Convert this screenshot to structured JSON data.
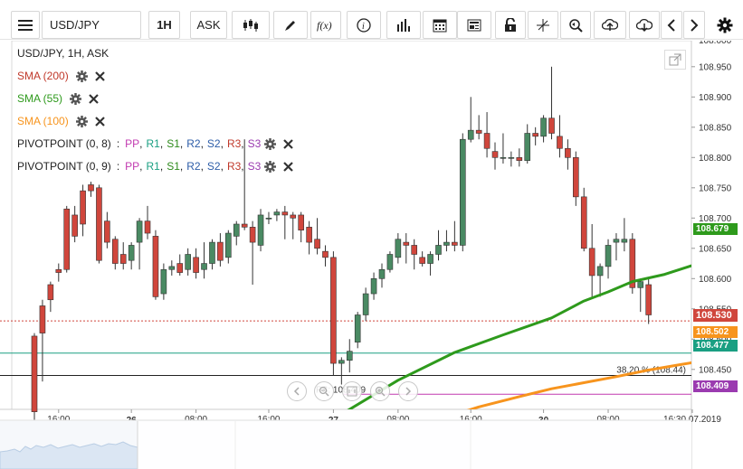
{
  "toolbar": {
    "symbol": "USD/JPY",
    "interval": "1H",
    "price_type": "ASK"
  },
  "legend": {
    "title": "USD/JPY, 1H, ASK",
    "sma200": "SMA (200)",
    "sma55": "SMA (55)",
    "sma100": "SMA (100)",
    "pivot1_label": "PIVOTPOINT (0, 8)",
    "pivot2_label": "PIVOTPOINT (0, 9)",
    "pivot_sep": ":",
    "pivot_parts": [
      "PP",
      "R1",
      "S1",
      "R2",
      "S2",
      "R3",
      "S3"
    ],
    "comma": ","
  },
  "colors": {
    "up": "#4a8a63",
    "down": "#d0463c",
    "sma55": "#2e9a1c",
    "sma100": "#f7941d",
    "sma200": "#c0392b",
    "teal": "#1a9f82",
    "pivot_pink": "#c23ab0",
    "pp": "#c23ab0",
    "r1": "#1a9f82",
    "s1": "#2e8a1c",
    "r2": "#2d5da8",
    "s2": "#2d5da8",
    "r3": "#c0392b",
    "s3": "#9b3bb0"
  },
  "chart_data": {
    "type": "candlestick",
    "ylim": [
      108.384,
      108.993
    ],
    "y_ticks": [
      "108.950",
      "108.900",
      "108.850",
      "108.800",
      "108.750",
      "108.700",
      "108.650",
      "108.600",
      "108.550",
      "108.500",
      "108.450"
    ],
    "top_partial_tick": "108.000",
    "x_ticks": [
      "16:00",
      "26",
      "08:00",
      "16:00",
      "27",
      "08:00",
      "16:00",
      "30",
      "08:00",
      "16:30.07.2019"
    ],
    "price_labels": {
      "sma55": "108.679",
      "last": "108.530",
      "sma100": "108.502",
      "teal_line": "108.477",
      "pivot": "108.409"
    },
    "fib_label": "38.20 % (108.44)",
    "pivot_text": "PS: 108.409",
    "candles": [
      [
        108.505,
        108.51,
        108.35,
        108.38
      ],
      [
        108.555,
        108.565,
        108.43,
        108.51
      ],
      [
        108.59,
        108.595,
        108.545,
        108.565
      ],
      [
        108.615,
        108.625,
        108.595,
        108.61
      ],
      [
        108.715,
        108.72,
        108.61,
        108.615
      ],
      [
        108.705,
        108.72,
        108.66,
        108.67
      ],
      [
        108.745,
        108.755,
        108.67,
        108.69
      ],
      [
        108.755,
        108.76,
        108.735,
        108.745
      ],
      [
        108.75,
        108.755,
        108.625,
        108.63
      ],
      [
        108.695,
        108.71,
        108.65,
        108.66
      ],
      [
        108.665,
        108.67,
        108.615,
        108.625
      ],
      [
        108.64,
        108.66,
        108.615,
        108.625
      ],
      [
        108.63,
        108.66,
        108.615,
        108.655
      ],
      [
        108.66,
        108.7,
        108.615,
        108.695
      ],
      [
        108.695,
        108.72,
        108.665,
        108.675
      ],
      [
        108.67,
        108.68,
        108.565,
        108.57
      ],
      [
        108.575,
        108.625,
        108.565,
        108.615
      ],
      [
        108.615,
        108.63,
        108.605,
        108.62
      ],
      [
        108.625,
        108.64,
        108.605,
        108.61
      ],
      [
        108.615,
        108.65,
        108.605,
        108.64
      ],
      [
        108.635,
        108.65,
        108.6,
        108.61
      ],
      [
        108.615,
        108.66,
        108.6,
        108.625
      ],
      [
        108.625,
        108.665,
        108.615,
        108.66
      ],
      [
        108.66,
        108.675,
        108.62,
        108.63
      ],
      [
        108.635,
        108.68,
        108.625,
        108.675
      ],
      [
        108.67,
        108.695,
        108.655,
        108.69
      ],
      [
        108.69,
        108.83,
        108.68,
        108.685
      ],
      [
        108.685,
        108.695,
        108.59,
        108.66
      ],
      [
        108.655,
        108.715,
        108.645,
        108.705
      ],
      [
        108.7,
        108.71,
        108.69,
        108.7
      ],
      [
        108.705,
        108.715,
        108.695,
        108.71
      ],
      [
        108.71,
        108.72,
        108.665,
        108.705
      ],
      [
        108.705,
        108.71,
        108.665,
        108.7
      ],
      [
        108.705,
        108.71,
        108.66,
        108.68
      ],
      [
        108.685,
        108.695,
        108.64,
        108.66
      ],
      [
        108.665,
        108.7,
        108.64,
        108.65
      ],
      [
        108.645,
        108.655,
        108.62,
        108.635
      ],
      [
        108.635,
        108.645,
        108.44,
        108.46
      ],
      [
        108.46,
        108.47,
        108.425,
        108.465
      ],
      [
        108.465,
        108.5,
        108.445,
        108.48
      ],
      [
        108.495,
        108.545,
        108.485,
        108.54
      ],
      [
        108.54,
        108.585,
        108.53,
        108.575
      ],
      [
        108.575,
        108.61,
        108.565,
        108.6
      ],
      [
        108.6,
        108.625,
        108.585,
        108.615
      ],
      [
        108.615,
        108.645,
        108.61,
        108.64
      ],
      [
        108.635,
        108.675,
        108.625,
        108.665
      ],
      [
        108.66,
        108.675,
        108.625,
        108.655
      ],
      [
        108.655,
        108.665,
        108.615,
        108.64
      ],
      [
        108.635,
        108.645,
        108.62,
        108.625
      ],
      [
        108.625,
        108.645,
        108.605,
        108.64
      ],
      [
        108.64,
        108.68,
        108.63,
        108.655
      ],
      [
        108.655,
        108.68,
        108.645,
        108.66
      ],
      [
        108.66,
        108.695,
        108.645,
        108.655
      ],
      [
        108.655,
        108.84,
        108.645,
        108.83
      ],
      [
        108.83,
        108.9,
        108.825,
        108.845
      ],
      [
        108.845,
        108.87,
        108.83,
        108.84
      ],
      [
        108.84,
        108.875,
        108.8,
        108.815
      ],
      [
        108.81,
        108.825,
        108.78,
        108.8
      ],
      [
        108.8,
        108.84,
        108.79,
        108.8
      ],
      [
        108.8,
        108.81,
        108.785,
        108.8
      ],
      [
        108.8,
        108.815,
        108.785,
        108.795
      ],
      [
        108.795,
        108.855,
        108.79,
        108.84
      ],
      [
        108.84,
        108.85,
        108.82,
        108.835
      ],
      [
        108.835,
        108.87,
        108.825,
        108.865
      ],
      [
        108.865,
        108.95,
        108.83,
        108.84
      ],
      [
        108.835,
        108.87,
        108.8,
        108.815
      ],
      [
        108.815,
        108.83,
        108.78,
        108.8
      ],
      [
        108.8,
        108.81,
        108.72,
        108.735
      ],
      [
        108.735,
        108.75,
        108.645,
        108.65
      ],
      [
        108.65,
        108.69,
        108.57,
        108.605
      ],
      [
        108.605,
        108.625,
        108.57,
        108.62
      ],
      [
        108.62,
        108.665,
        108.6,
        108.655
      ],
      [
        108.66,
        108.675,
        108.63,
        108.665
      ],
      [
        108.66,
        108.7,
        108.645,
        108.665
      ],
      [
        108.665,
        108.675,
        108.575,
        108.585
      ],
      [
        108.585,
        108.6,
        108.545,
        108.595
      ],
      [
        108.59,
        108.6,
        108.525,
        108.54
      ]
    ],
    "sma55_points": [
      [
        36,
        108.36
      ],
      [
        45,
        108.432
      ],
      [
        52,
        108.478
      ],
      [
        58,
        108.507
      ],
      [
        64,
        108.535
      ],
      [
        68,
        108.563
      ],
      [
        71,
        108.578
      ],
      [
        74,
        108.595
      ],
      [
        78,
        108.607
      ],
      [
        81,
        108.62
      ],
      [
        84,
        108.633
      ],
      [
        87,
        108.645
      ],
      [
        91,
        108.657
      ],
      [
        95,
        108.664
      ],
      [
        98,
        108.673
      ],
      [
        101,
        108.679
      ],
      [
        104,
        108.682
      ],
      [
        108,
        108.683
      ],
      [
        112,
        108.681
      ],
      [
        116,
        108.679
      ]
    ],
    "sma100_points": [
      [
        36,
        108.322
      ],
      [
        45,
        108.348
      ],
      [
        50,
        108.367
      ],
      [
        55,
        108.388
      ],
      [
        60,
        108.405
      ],
      [
        64,
        108.418
      ],
      [
        68,
        108.428
      ],
      [
        72,
        108.438
      ],
      [
        76,
        108.449
      ],
      [
        80,
        108.458
      ],
      [
        84,
        108.467
      ],
      [
        88,
        108.476
      ],
      [
        92,
        108.484
      ],
      [
        96,
        108.49
      ],
      [
        100,
        108.496
      ],
      [
        104,
        108.5
      ],
      [
        108,
        108.502
      ]
    ]
  }
}
